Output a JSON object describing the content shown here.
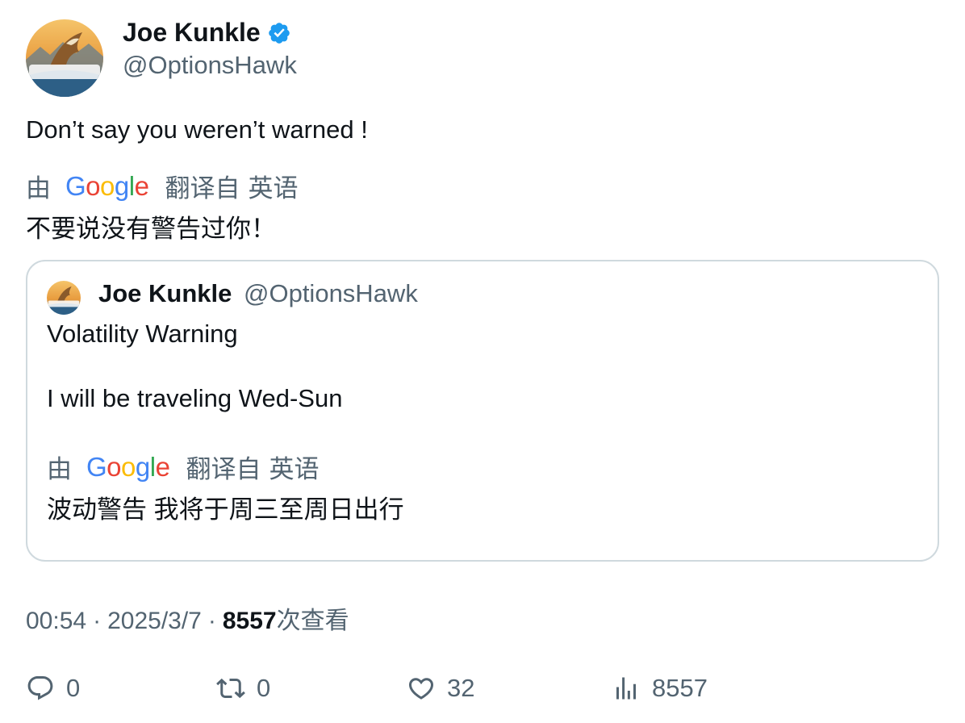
{
  "tweet": {
    "author_name": "Joe Kunkle",
    "author_handle": "@OptionsHawk",
    "avatar_text": "OptionsHawk",
    "text": "Don’t say you weren’t warned !",
    "translation": {
      "by_label": "由",
      "google_letters": [
        "G",
        "o",
        "o",
        "g",
        "l",
        "e"
      ],
      "translated_from_label": "翻译自",
      "language": "英语",
      "text": "不要说没有警告过你！"
    }
  },
  "quote": {
    "author_name": "Joe Kunkle",
    "author_handle": "@OptionsHawk",
    "line1": "Volatility Warning",
    "line2": "I will be traveling Wed-Sun",
    "translation": {
      "by_label": "由",
      "translated_from_label": "翻译自",
      "language": "英语",
      "text": "波动警告 我将于周三至周日出行"
    }
  },
  "meta": {
    "time": "00:54",
    "separator": "·",
    "date": "2025/3/7",
    "views_count": "8557",
    "views_label": "次查看"
  },
  "actions": {
    "reply_count": "0",
    "retweet_count": "0",
    "like_count": "32",
    "views_count": "8557"
  },
  "colors": {
    "verified": "#1d9bf0",
    "secondary_text": "#536471",
    "border": "#cfd9de"
  },
  "icons": [
    "verified-badge-icon",
    "reply-icon",
    "retweet-icon",
    "like-icon",
    "views-icon"
  ]
}
